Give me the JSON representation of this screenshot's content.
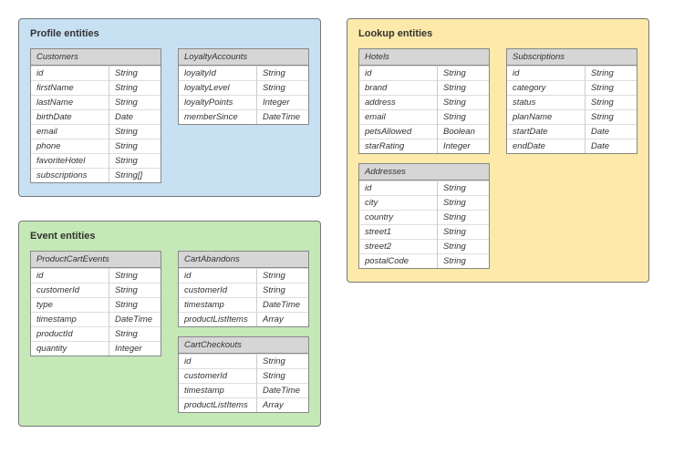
{
  "groups": {
    "profile": {
      "title": "Profile entities",
      "tables": {
        "customers": {
          "name": "Customers",
          "fields": [
            {
              "n": "id",
              "t": "String"
            },
            {
              "n": "firstName",
              "t": "String"
            },
            {
              "n": "lastName",
              "t": "String"
            },
            {
              "n": "birthDate",
              "t": "Date"
            },
            {
              "n": "email",
              "t": "String"
            },
            {
              "n": "phone",
              "t": "String"
            },
            {
              "n": "favoriteHotel",
              "t": "String"
            },
            {
              "n": "subscriptions",
              "t": "String[]"
            }
          ]
        },
        "loyalty": {
          "name": "LoyaltyAccounts",
          "fields": [
            {
              "n": "loyaltyId",
              "t": "String"
            },
            {
              "n": "loyaltyLevel",
              "t": "String"
            },
            {
              "n": "loyaltyPoints",
              "t": "Integer"
            },
            {
              "n": "memberSince",
              "t": "DateTime"
            }
          ]
        }
      }
    },
    "event": {
      "title": "Event entities",
      "tables": {
        "pce": {
          "name": "ProductCartEvents",
          "fields": [
            {
              "n": "id",
              "t": "String"
            },
            {
              "n": "customerId",
              "t": "String"
            },
            {
              "n": "type",
              "t": "String"
            },
            {
              "n": "timestamp",
              "t": "DateTime"
            },
            {
              "n": "productId",
              "t": "String"
            },
            {
              "n": "quantity",
              "t": "Integer"
            }
          ]
        },
        "ab": {
          "name": "CartAbandons",
          "fields": [
            {
              "n": "id",
              "t": "String"
            },
            {
              "n": "customerId",
              "t": "String"
            },
            {
              "n": "timestamp",
              "t": "DateTime"
            },
            {
              "n": "productListItems",
              "t": "Array"
            }
          ]
        },
        "co": {
          "name": "CartCheckouts",
          "fields": [
            {
              "n": "id",
              "t": "String"
            },
            {
              "n": "customerId",
              "t": "String"
            },
            {
              "n": "timestamp",
              "t": "DateTime"
            },
            {
              "n": "productListItems",
              "t": "Array"
            }
          ]
        }
      }
    },
    "lookup": {
      "title": "Lookup entities",
      "tables": {
        "hotels": {
          "name": "Hotels",
          "fields": [
            {
              "n": "id",
              "t": "String"
            },
            {
              "n": "brand",
              "t": "String"
            },
            {
              "n": "address",
              "t": "String"
            },
            {
              "n": "email",
              "t": "String"
            },
            {
              "n": "petsAllowed",
              "t": "Boolean"
            },
            {
              "n": "starRating",
              "t": "Integer"
            }
          ]
        },
        "subs": {
          "name": "Subscriptions",
          "fields": [
            {
              "n": "id",
              "t": "String"
            },
            {
              "n": "category",
              "t": "String"
            },
            {
              "n": "status",
              "t": "String"
            },
            {
              "n": "planName",
              "t": "String"
            },
            {
              "n": "startDate",
              "t": "Date"
            },
            {
              "n": "endDate",
              "t": "Date"
            }
          ]
        },
        "addr": {
          "name": "Addresses",
          "fields": [
            {
              "n": "id",
              "t": "String"
            },
            {
              "n": "city",
              "t": "String"
            },
            {
              "n": "country",
              "t": "String"
            },
            {
              "n": "street1",
              "t": "String"
            },
            {
              "n": "street2",
              "t": "String"
            },
            {
              "n": "postalCode",
              "t": "String"
            }
          ]
        }
      }
    }
  }
}
